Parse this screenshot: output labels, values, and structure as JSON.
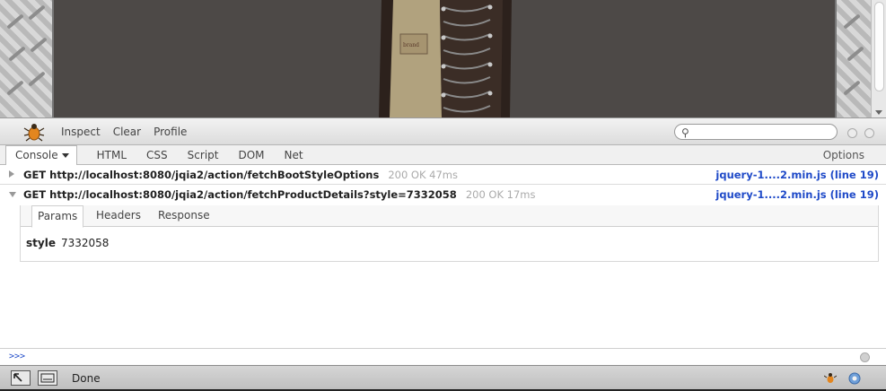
{
  "toolbar": {
    "buttons": [
      "Inspect",
      "Clear",
      "Profile"
    ],
    "search_placeholder": ""
  },
  "tabs": {
    "items": [
      "Console",
      "HTML",
      "CSS",
      "Script",
      "DOM",
      "Net"
    ],
    "options_label": "Options"
  },
  "console": {
    "rows": [
      {
        "request": "GET http://localhost:8080/jqia2/action/fetchBootStyleOptions",
        "status": "200 OK 47ms",
        "source": "jquery-1....2.min.js (line 19)",
        "expanded": false
      },
      {
        "request": "GET http://localhost:8080/jqia2/action/fetchProductDetails?style=7332058",
        "status": "200 OK 17ms",
        "source": "jquery-1....2.min.js (line 19)",
        "expanded": true
      }
    ],
    "detail_tabs": [
      "Params",
      "Headers",
      "Response"
    ],
    "params": [
      {
        "name": "style",
        "value": "7332058"
      }
    ]
  },
  "command_line": {
    "prompt": ">>>"
  },
  "statusbar": {
    "text": "Done"
  },
  "colors": {
    "link": "#1f4ac8",
    "status_gray": "#aaaaaa",
    "page_background": "#4d4947"
  },
  "icons": [
    "firebug-bug-icon",
    "search-icon",
    "status-inspect-icon",
    "status-console-icon",
    "yslow-icon"
  ]
}
